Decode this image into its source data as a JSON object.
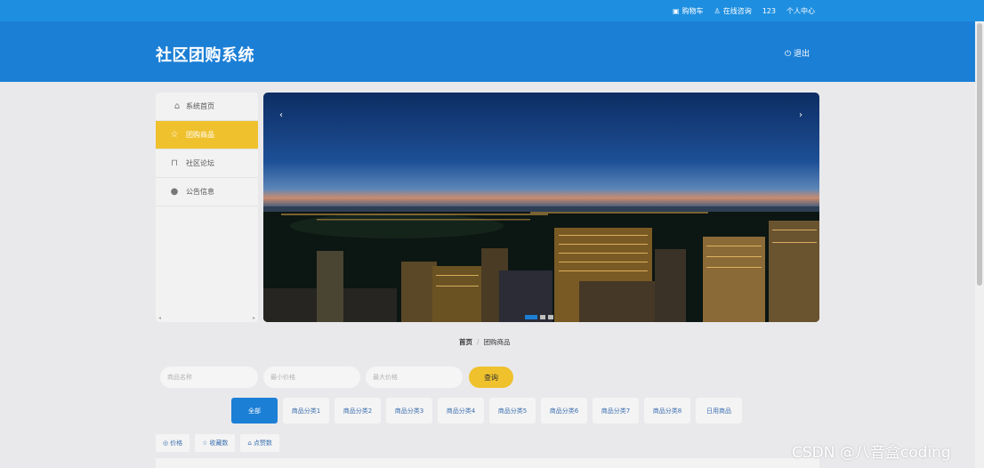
{
  "topbar": {
    "links": [
      {
        "icon": "cart-icon",
        "glyph": "🛒",
        "label": "购物车"
      },
      {
        "icon": "user-service-icon",
        "glyph": "⚇",
        "label": "在线咨询"
      },
      {
        "icon": "",
        "glyph": "",
        "label": "123"
      },
      {
        "icon": "",
        "glyph": "",
        "label": "个人中心"
      }
    ]
  },
  "header": {
    "title": "社区团购系统",
    "logout_label": "退出"
  },
  "sidebar": {
    "items": [
      {
        "icon": "home-icon",
        "label": "系统首页",
        "active": false
      },
      {
        "icon": "star-icon",
        "label": "团购商品",
        "active": true
      },
      {
        "icon": "bag-icon",
        "label": "社区论坛",
        "active": false
      },
      {
        "icon": "info-icon",
        "label": "公告信息",
        "active": false
      }
    ]
  },
  "banner": {
    "image": "city skyline at dusk",
    "active_slide": 1,
    "slide_count": 3
  },
  "breadcrumb": {
    "home": "首页",
    "separator": "/",
    "current": "团购商品"
  },
  "search": {
    "name_placeholder": "商品名称",
    "min_price_placeholder": "最小价格",
    "max_price_placeholder": "最大价格",
    "button_label": "查询"
  },
  "categories": [
    "全部",
    "商品分类1",
    "商品分类2",
    "商品分类3",
    "商品分类4",
    "商品分类5",
    "商品分类6",
    "商品分类7",
    "商品分类8",
    "日用商品"
  ],
  "sort": {
    "price_label": "价格",
    "favorites_label": "收藏数",
    "likes_label": "点赞数"
  },
  "watermark": "CSDN @八音盒coding",
  "colors": {
    "topbar": "#1e8fe0",
    "header": "#1c7fd6",
    "accent_yellow": "#efc12d",
    "page_bg": "#e9e9ec"
  }
}
